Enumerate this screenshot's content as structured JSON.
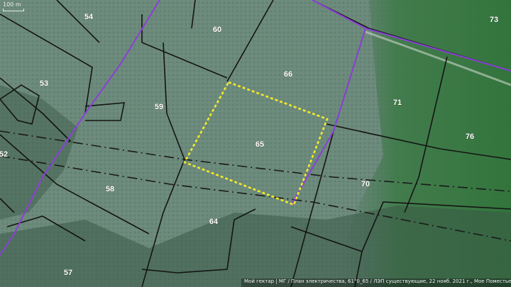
{
  "map": {
    "scale_label": "100 m",
    "attribution": "Мой гектар | МГ / План электричества, 61°0_65 / ЛЭП существующие, 22 нояб. 2021 г., Мое Поместье, Поселок фермеров, 4463, 237",
    "colors": {
      "parcel_line": "#141414",
      "boundary_line": "#8c3fd8",
      "selection": "#f3ea2a",
      "forest": "#2f7a3a",
      "field": "#6f8d7c"
    },
    "parcels": [
      {
        "id": "54",
        "label": "54"
      },
      {
        "id": "60",
        "label": "60"
      },
      {
        "id": "73",
        "label": "73"
      },
      {
        "id": "53",
        "label": "53"
      },
      {
        "id": "66",
        "label": "66"
      },
      {
        "id": "59",
        "label": "59"
      },
      {
        "id": "71",
        "label": "71"
      },
      {
        "id": "76",
        "label": "76"
      },
      {
        "id": "65",
        "label": "65"
      },
      {
        "id": "52",
        "label": "52"
      },
      {
        "id": "70",
        "label": "70"
      },
      {
        "id": "58",
        "label": "58"
      },
      {
        "id": "64",
        "label": "64"
      },
      {
        "id": "57",
        "label": "57"
      }
    ],
    "selected_parcel": "65"
  }
}
